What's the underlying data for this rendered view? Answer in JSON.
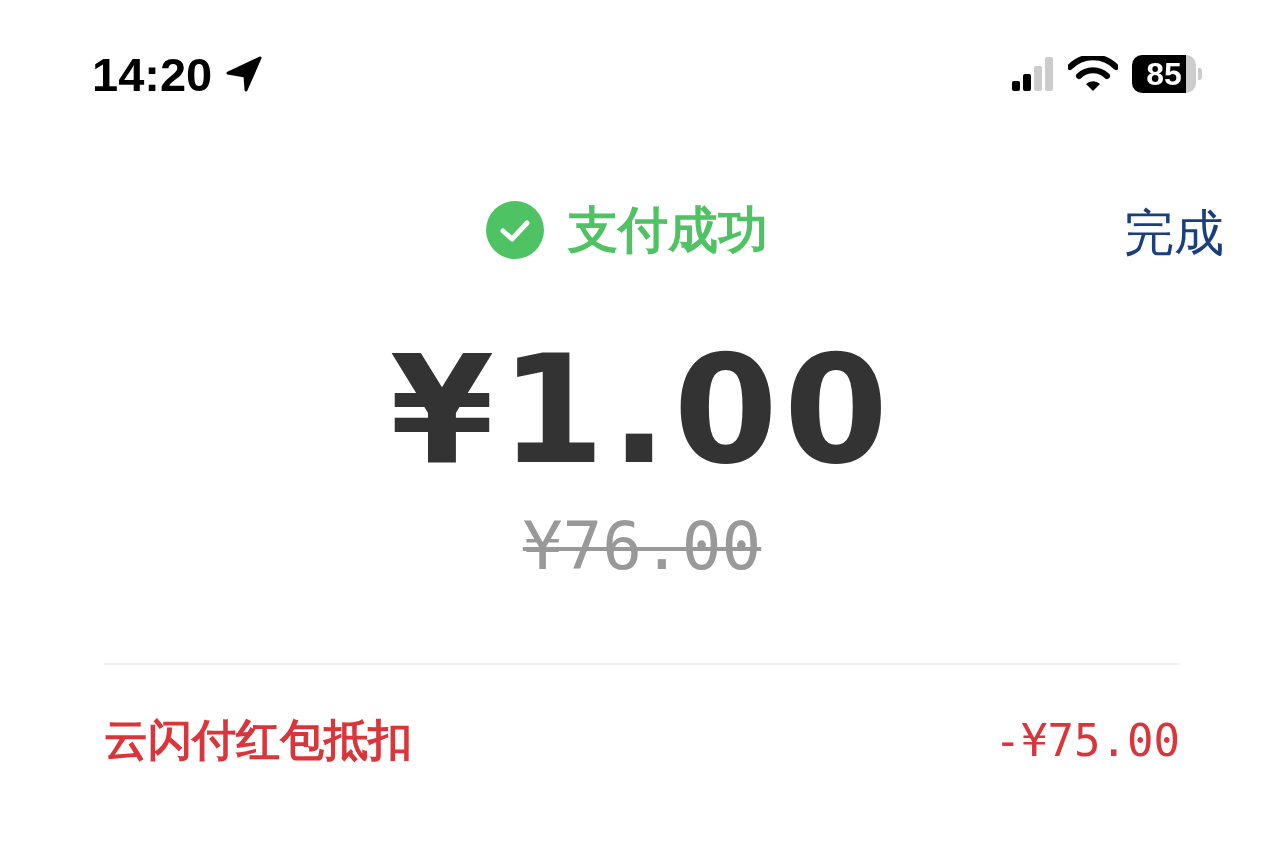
{
  "status_bar": {
    "time": "14:20",
    "battery": "85"
  },
  "header": {
    "status": "支付成功",
    "done_button": "完成"
  },
  "payment": {
    "amount": "¥1.00",
    "original_amount": "¥76.00"
  },
  "discounts": [
    {
      "label": "云闪付红包抵扣",
      "amount": "-¥75.00"
    }
  ]
}
